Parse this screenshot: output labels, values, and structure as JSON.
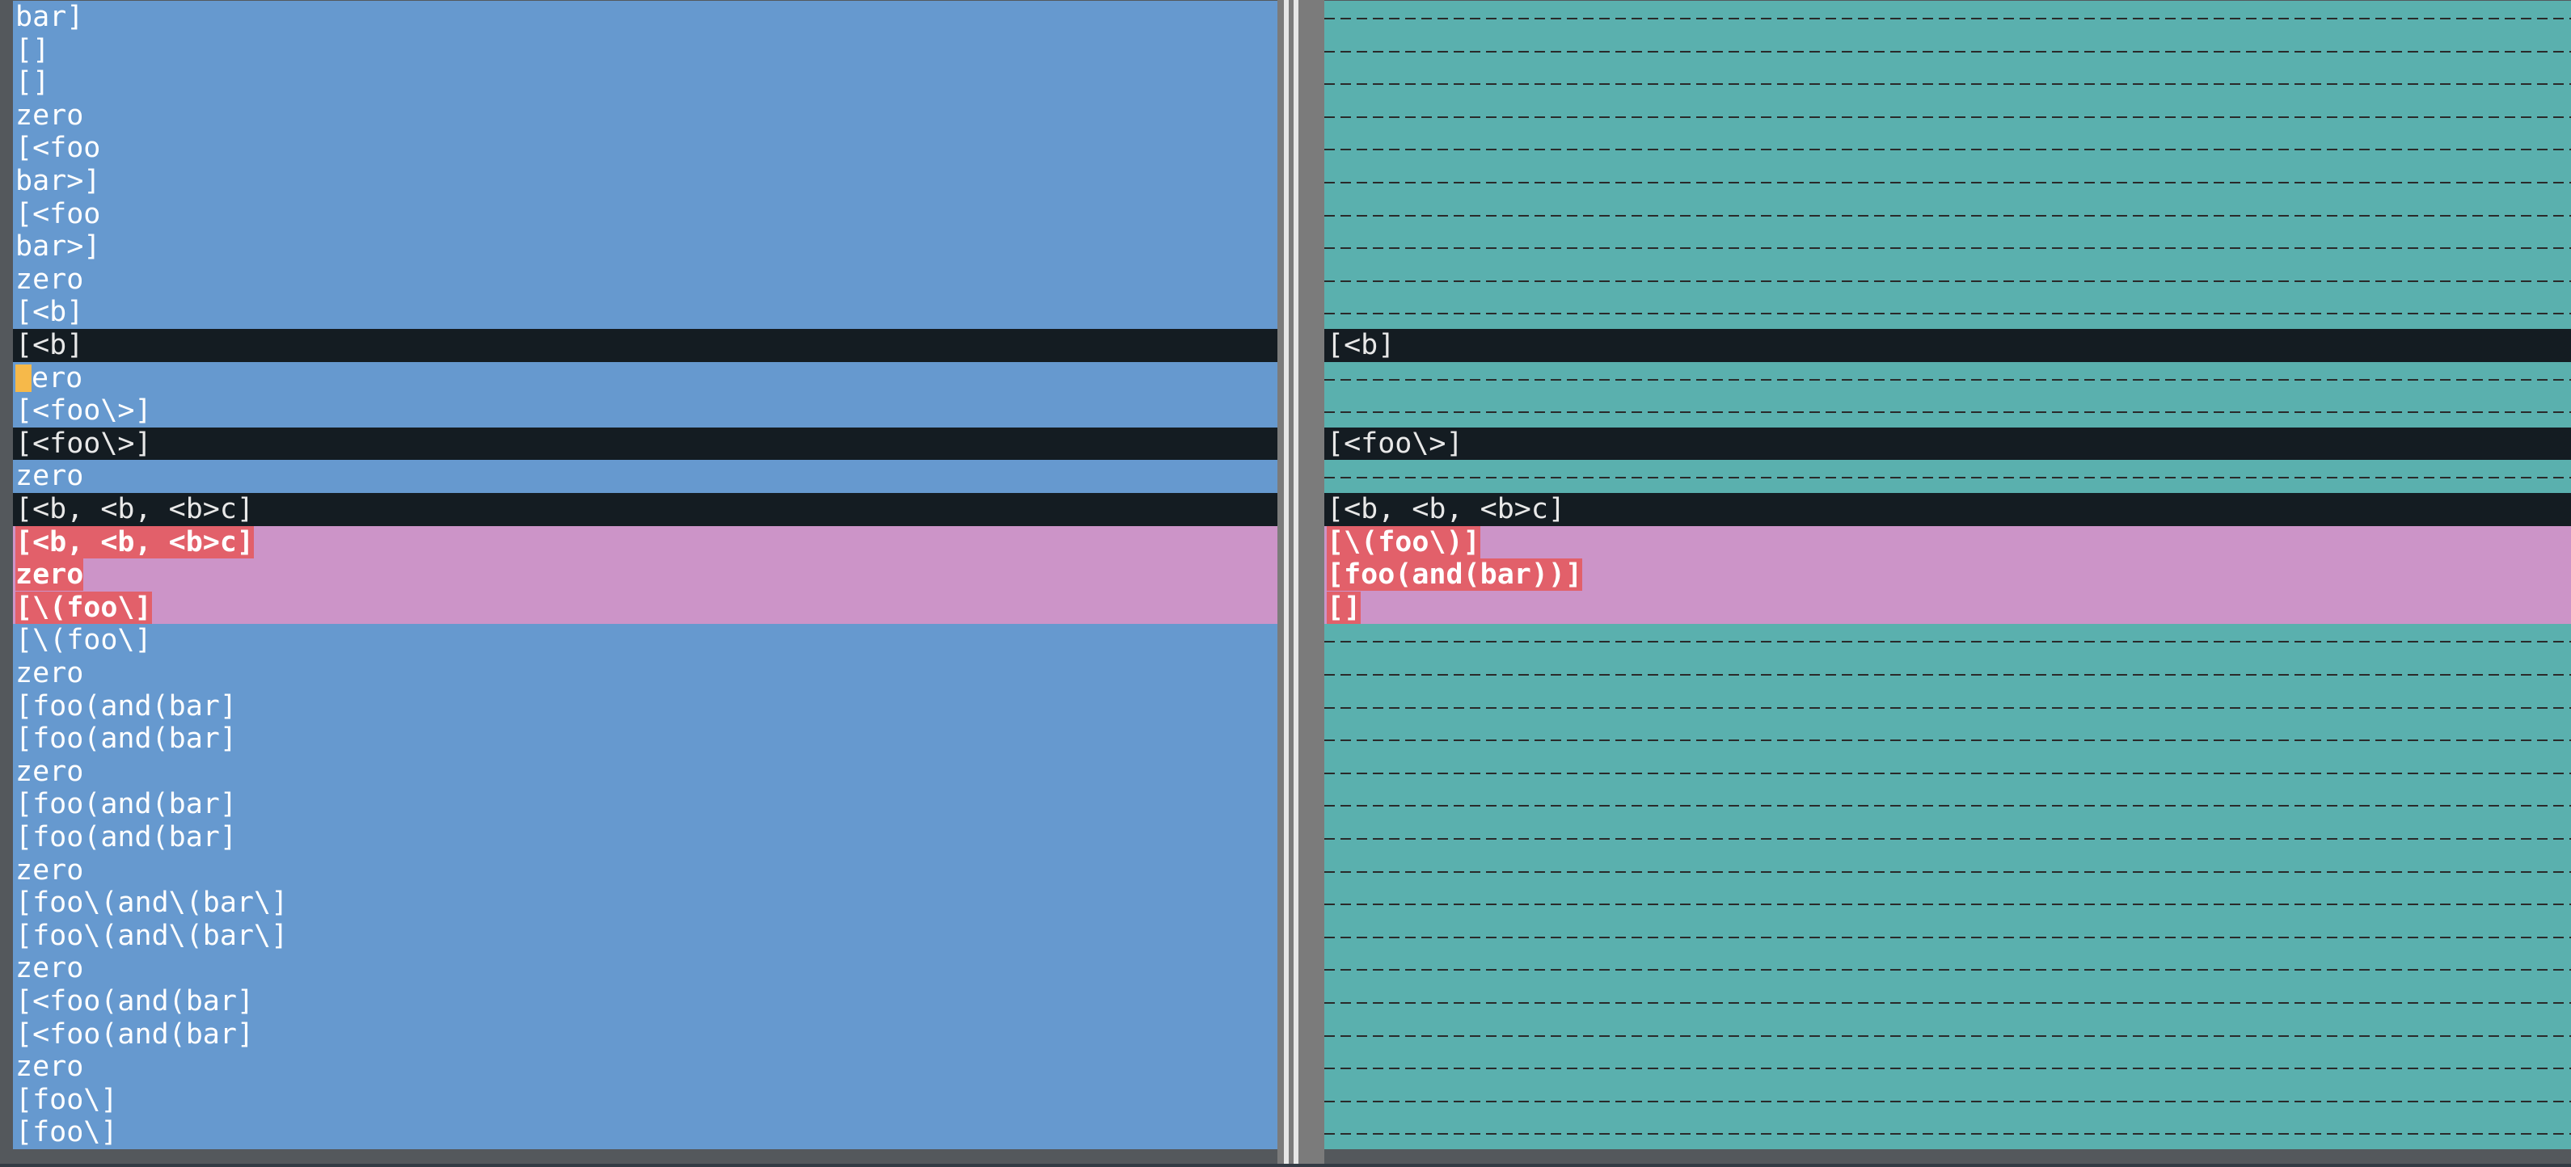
{
  "left_pane": {
    "lines": [
      {
        "text": "bar]",
        "kind": "normal"
      },
      {
        "text": "[]",
        "kind": "normal"
      },
      {
        "text": "[]",
        "kind": "normal"
      },
      {
        "text": "zero",
        "kind": "normal"
      },
      {
        "text": "[<foo",
        "kind": "normal"
      },
      {
        "text": "bar>]",
        "kind": "normal"
      },
      {
        "text": "[<foo",
        "kind": "normal"
      },
      {
        "text": "bar>]",
        "kind": "normal"
      },
      {
        "text": "zero",
        "kind": "normal"
      },
      {
        "text": "[<b]",
        "kind": "normal"
      },
      {
        "text": "[<b]",
        "kind": "selected"
      },
      {
        "text": "ero",
        "kind": "cursor"
      },
      {
        "text": "[<foo\\>]",
        "kind": "normal"
      },
      {
        "text": "[<foo\\>]",
        "kind": "selected"
      },
      {
        "text": "zero",
        "kind": "normal"
      },
      {
        "text": "[<b, <b, <b>c]",
        "kind": "selected"
      },
      {
        "text": "[<b, <b, <b>c]",
        "kind": "diff"
      },
      {
        "text": "zero",
        "kind": "diff"
      },
      {
        "text": "[\\(foo\\]",
        "kind": "diff"
      },
      {
        "text": "[\\(foo\\]",
        "kind": "normal"
      },
      {
        "text": "zero",
        "kind": "normal"
      },
      {
        "text": "[foo(and(bar]",
        "kind": "normal"
      },
      {
        "text": "[foo(and(bar]",
        "kind": "normal"
      },
      {
        "text": "zero",
        "kind": "normal"
      },
      {
        "text": "[foo(and(bar]",
        "kind": "normal"
      },
      {
        "text": "[foo(and(bar]",
        "kind": "normal"
      },
      {
        "text": "zero",
        "kind": "normal"
      },
      {
        "text": "[foo\\(and\\(bar\\]",
        "kind": "normal"
      },
      {
        "text": "[foo\\(and\\(bar\\]",
        "kind": "normal"
      },
      {
        "text": "zero",
        "kind": "normal"
      },
      {
        "text": "[<foo(and(bar]",
        "kind": "normal"
      },
      {
        "text": "[<foo(and(bar]",
        "kind": "normal"
      },
      {
        "text": "zero",
        "kind": "normal"
      },
      {
        "text": "[foo\\]",
        "kind": "normal"
      },
      {
        "text": "[foo\\]",
        "kind": "normal"
      }
    ]
  },
  "right_pane": {
    "lines": [
      {
        "text": "",
        "kind": "filler"
      },
      {
        "text": "",
        "kind": "filler"
      },
      {
        "text": "",
        "kind": "filler"
      },
      {
        "text": "",
        "kind": "filler"
      },
      {
        "text": "",
        "kind": "filler"
      },
      {
        "text": "",
        "kind": "filler"
      },
      {
        "text": "",
        "kind": "filler"
      },
      {
        "text": "",
        "kind": "filler"
      },
      {
        "text": "",
        "kind": "filler"
      },
      {
        "text": "",
        "kind": "filler"
      },
      {
        "text": "[<b]",
        "kind": "selected"
      },
      {
        "text": "",
        "kind": "filler"
      },
      {
        "text": "",
        "kind": "filler"
      },
      {
        "text": "[<foo\\>]",
        "kind": "selected"
      },
      {
        "text": "",
        "kind": "filler"
      },
      {
        "text": "[<b, <b, <b>c]",
        "kind": "selected"
      },
      {
        "text": "[\\(foo\\)]",
        "kind": "diff"
      },
      {
        "text": "[foo(and(bar))]",
        "kind": "diff"
      },
      {
        "text": "[]",
        "kind": "diff"
      },
      {
        "text": "",
        "kind": "filler"
      },
      {
        "text": "",
        "kind": "filler"
      },
      {
        "text": "",
        "kind": "filler"
      },
      {
        "text": "",
        "kind": "filler"
      },
      {
        "text": "",
        "kind": "filler"
      },
      {
        "text": "",
        "kind": "filler"
      },
      {
        "text": "",
        "kind": "filler"
      },
      {
        "text": "",
        "kind": "filler"
      },
      {
        "text": "",
        "kind": "filler"
      },
      {
        "text": "",
        "kind": "filler"
      },
      {
        "text": "",
        "kind": "filler"
      },
      {
        "text": "",
        "kind": "filler"
      },
      {
        "text": "",
        "kind": "filler"
      },
      {
        "text": "",
        "kind": "filler"
      },
      {
        "text": "",
        "kind": "filler"
      },
      {
        "text": "",
        "kind": "filler"
      }
    ]
  },
  "colors": {
    "left_bg": "#6699cf",
    "right_bg": "#5ab0ae",
    "selected_bg": "#141c22",
    "diff_bg": "#cc94c8",
    "diff_text_hl": "#e2606a",
    "cursor": "#f6b94a"
  }
}
